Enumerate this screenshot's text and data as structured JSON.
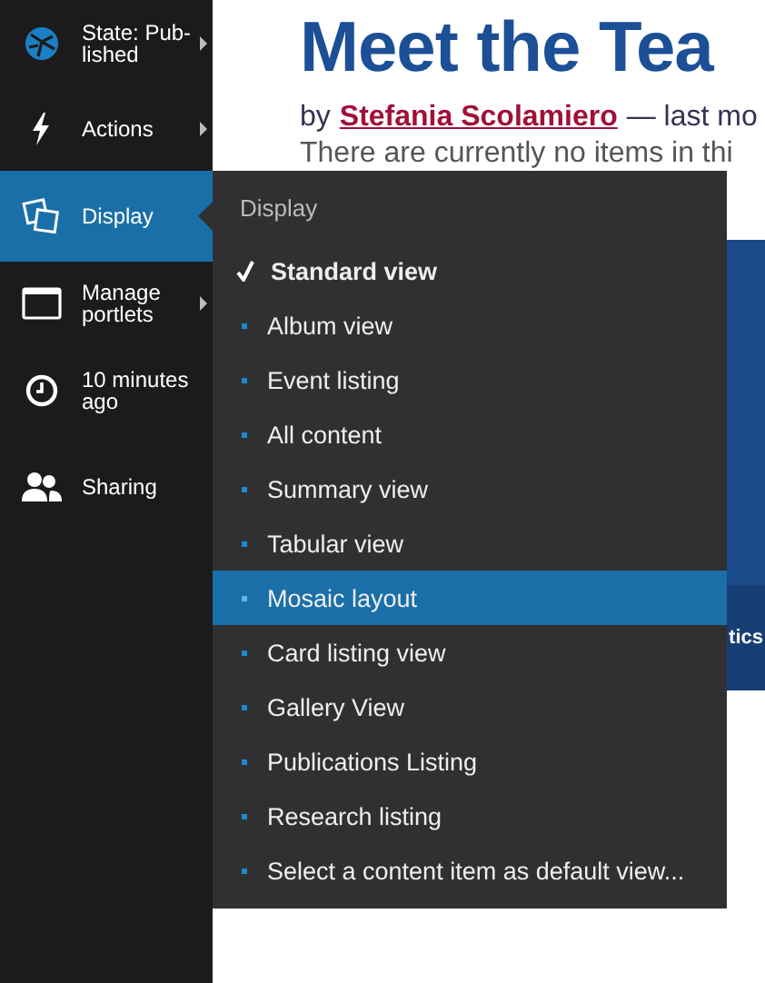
{
  "sidebar": {
    "items": [
      {
        "kind": "globe",
        "label": "State: Pub-\nlished",
        "has_submenu": true,
        "selected": false
      },
      {
        "kind": "bolt",
        "label": "Actions",
        "has_submenu": true,
        "selected": false
      },
      {
        "kind": "display",
        "label": "Display",
        "has_submenu": false,
        "selected": true
      },
      {
        "kind": "window",
        "label": "Manage\nportlets",
        "has_submenu": true,
        "selected": false
      },
      {
        "kind": "clock",
        "label": "10 minutes\nago",
        "has_submenu": false,
        "selected": false
      },
      {
        "kind": "users",
        "label": "Sharing",
        "has_submenu": false,
        "selected": false
      }
    ]
  },
  "page": {
    "title": "Meet the Tea",
    "byline_prefix": "by",
    "author": "Stefania Scolamiero",
    "byline_suffix": "— last mo",
    "notice": "There are currently no items in thi",
    "footer": "tics"
  },
  "menu": {
    "header": "Display",
    "items": [
      {
        "label": "Standard view",
        "checked": true,
        "selected": false
      },
      {
        "label": "Album view",
        "checked": false,
        "selected": false
      },
      {
        "label": "Event listing",
        "checked": false,
        "selected": false
      },
      {
        "label": "All content",
        "checked": false,
        "selected": false
      },
      {
        "label": "Summary view",
        "checked": false,
        "selected": false
      },
      {
        "label": "Tabular view",
        "checked": false,
        "selected": false
      },
      {
        "label": "Mosaic layout",
        "checked": false,
        "selected": true
      },
      {
        "label": "Card listing view",
        "checked": false,
        "selected": false
      },
      {
        "label": "Gallery View",
        "checked": false,
        "selected": false
      },
      {
        "label": "Publications Listing",
        "checked": false,
        "selected": false
      },
      {
        "label": "Research listing",
        "checked": false,
        "selected": false
      },
      {
        "label": "Select a content item as default view...",
        "checked": false,
        "selected": false
      }
    ]
  }
}
